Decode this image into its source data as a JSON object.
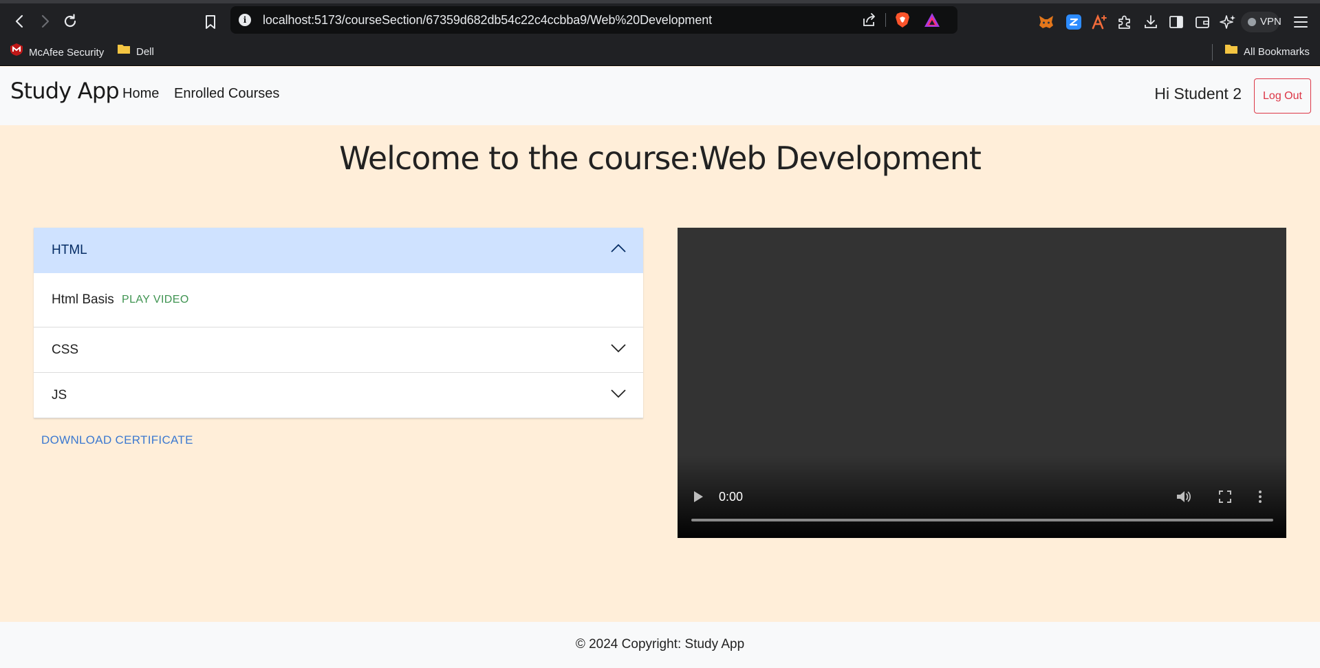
{
  "browser": {
    "url": "localhost:5173/courseSection/67359d682db54c22c4ccbba9/Web%20Development",
    "vpn_label": "VPN",
    "bookmarks": [
      {
        "label": "McAfee Security",
        "icon": "mcafee-icon"
      },
      {
        "label": "Dell",
        "icon": "folder-icon"
      }
    ],
    "all_bookmarks_label": "All Bookmarks",
    "colors": {
      "chrome_bg": "#202124",
      "urlbar_bg": "#0f1011"
    }
  },
  "navbar": {
    "brand": "Study App",
    "links": [
      "Home",
      "Enrolled Courses"
    ],
    "greeting": "Hi Student 2",
    "logout_label": "Log Out"
  },
  "page": {
    "heading": "Welcome to the course:Web Development",
    "sections": [
      {
        "title": "HTML",
        "expanded": true,
        "lessons": [
          {
            "name": "Html Basis",
            "action": "PLAY VIDEO"
          }
        ]
      },
      {
        "title": "CSS",
        "expanded": false
      },
      {
        "title": "JS",
        "expanded": false
      }
    ],
    "certificate_label": "DOWNLOAD CERTIFICATE",
    "video": {
      "time": "0:00"
    }
  },
  "footer": {
    "text": "© 2024 Copyright: Study App"
  },
  "colors": {
    "page_bg": "#ffeed9",
    "accordion_active": "#cfe2ff",
    "play_link": "#3e9350",
    "cert_link": "#3b78d0",
    "logout": "#dc3545"
  }
}
